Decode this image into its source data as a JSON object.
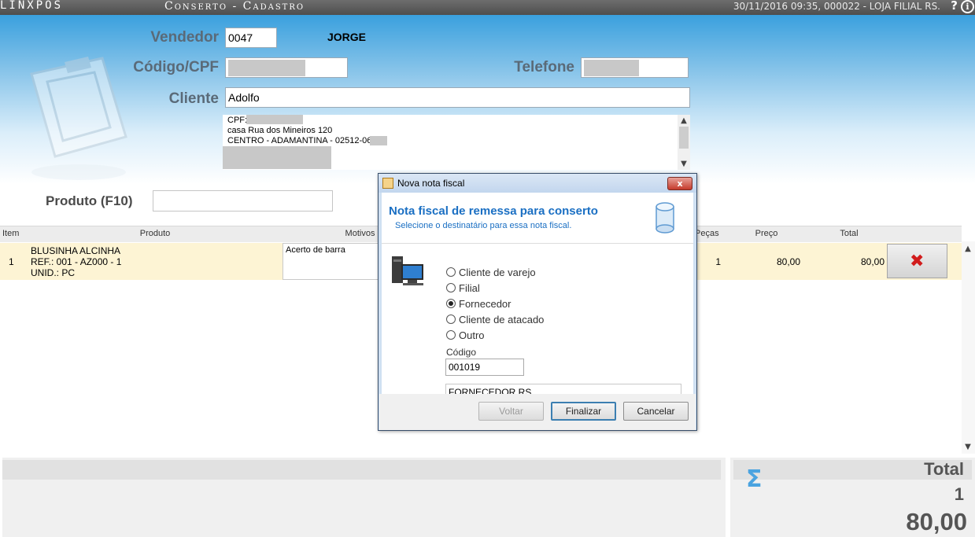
{
  "titlebar": {
    "logo": "LINXPOS",
    "screen_title": "Conserto - Cadastro",
    "status": "30/11/2016 09:35, 000022 - LOJA FILIAL RS.",
    "help": "?",
    "info": "i"
  },
  "form": {
    "vendedor_label": "Vendedor",
    "vendedor_code": "0047",
    "vendedor_name": "JORGE",
    "cpf_label": "Código/CPF",
    "telefone_label": "Telefone",
    "cliente_label": "Cliente",
    "cliente_value": "Adolfo",
    "address_lines": [
      "CPF:",
      "casa Rua dos Mineiros 120",
      "CENTRO - ADAMANTINA - 02512-060"
    ]
  },
  "product": {
    "label": "Produto (F10)",
    "search_value": ""
  },
  "grid": {
    "headers": {
      "item": "Item",
      "produto": "Produto",
      "motivos": "Motivos",
      "pecas": "Peças",
      "preco": "Preço",
      "total": "Total"
    },
    "rows": [
      {
        "item": "1",
        "produto_lines": [
          "BLUSINHA ALCINHA",
          "REF.: 001 - AZ000 - 1",
          "UNID.: PC"
        ],
        "motivo": "Acerto de barra",
        "pecas": "1",
        "preco": "80,00",
        "total": "80,00"
      }
    ]
  },
  "footer": {
    "total_label": "Total",
    "total_qty": "1",
    "total_value": "80,00"
  },
  "dialog": {
    "title": "Nova nota fiscal",
    "close": "x",
    "heading": "Nota fiscal de remessa para conserto",
    "subheading": "Selecione o destinatário para essa nota fiscal.",
    "options": [
      "Cliente de varejo",
      "Filial",
      "Fornecedor",
      "Cliente de atacado",
      "Outro"
    ],
    "selected_option": "Fornecedor",
    "code_label": "Código",
    "code_value": "001019",
    "name_value": "FORNECEDOR RS",
    "buttons": {
      "back": "Voltar",
      "finish": "Finalizar",
      "cancel": "Cancelar"
    }
  },
  "colors": {
    "accent_blue": "#1a6fc3",
    "header_blue": "#3aa0de",
    "row_highlight": "#fdf4d4",
    "delete_red": "#d11c1c"
  }
}
